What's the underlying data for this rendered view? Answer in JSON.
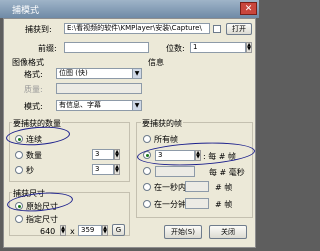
{
  "window": {
    "title": "捕模式",
    "close_label": "✕"
  },
  "capture_dir": {
    "label": "捕获到:",
    "value": "E:\\看视频的软件\\KMPlayer\\安装\\Capture\\",
    "open_label": "打开"
  },
  "prefix": {
    "label": "前缀:",
    "value": ""
  },
  "digits": {
    "label": "位数:",
    "value": "1"
  },
  "image_format": {
    "title": "图像格式",
    "format_label": "格式:",
    "format_value": "位图 (快)",
    "quality_label": "质量:",
    "mode_label": "模式:",
    "mode_value": "有信息、字幕"
  },
  "info": {
    "title": "信息"
  },
  "capture_count": {
    "title": "要捕获的数量",
    "continuous_label": "连续",
    "count_label": "数量",
    "count_value": "3",
    "seconds_label": "秒",
    "seconds_value": "3"
  },
  "capture_size": {
    "title": "捕获尺寸",
    "original_label": "原始尺寸",
    "custom_label": "指定尺寸",
    "width_value": "640",
    "times": "x",
    "height_value": "359",
    "g_label": "G"
  },
  "capture_frames": {
    "title": "要捕获的帧",
    "all_label": "所有帧",
    "every_value": "3",
    "every_suffix": ": 每 # 帧",
    "ms_suffix": "每 # 毫秒",
    "per_sec_label": "在一秒内",
    "per_sec_suffix": "# 帧",
    "per_min_label": "在一分钟",
    "per_min_suffix": "# 帧"
  },
  "footer": {
    "start_label": "开始(S)",
    "close_label": "关闭"
  },
  "colors": {
    "annotation": "#1b1f8c",
    "close": "#c9463d"
  }
}
